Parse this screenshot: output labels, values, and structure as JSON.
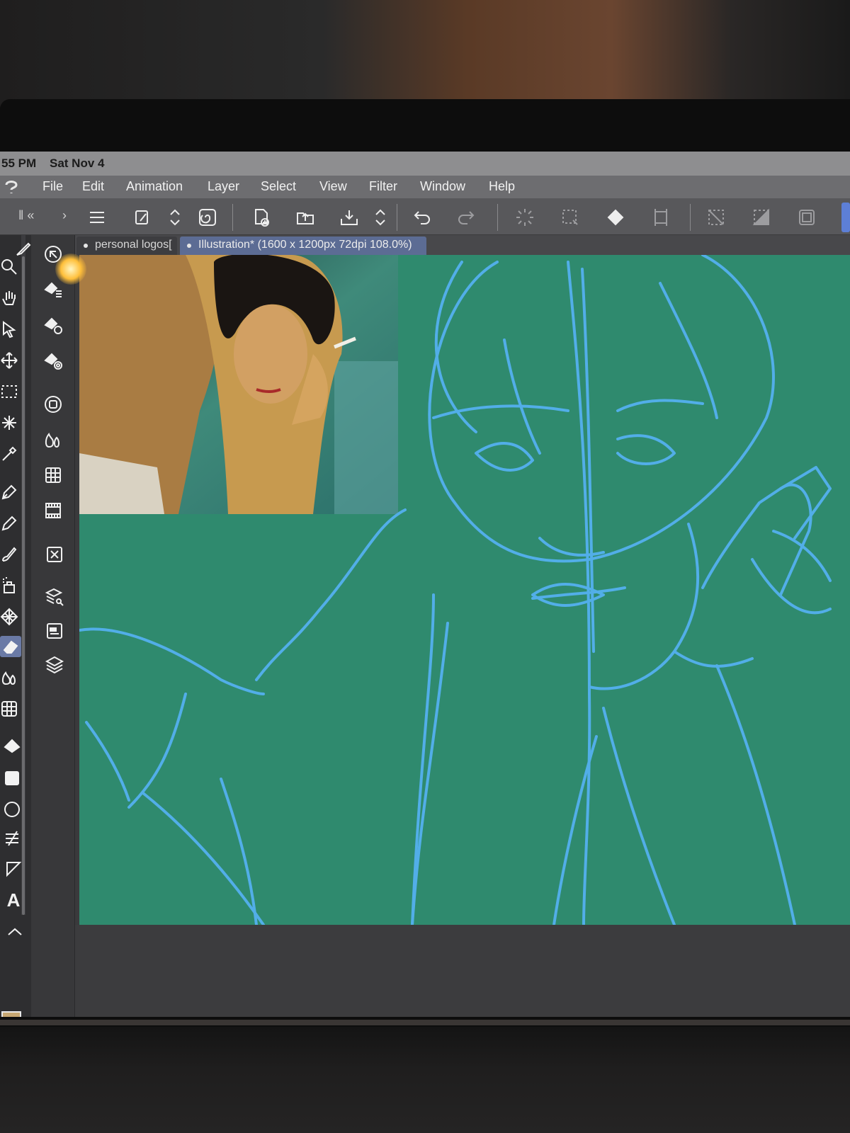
{
  "status_bar": {
    "time": "55 PM",
    "date": "Sat Nov 4"
  },
  "menu": {
    "items": [
      "File",
      "Edit",
      "Animation",
      "Layer",
      "Select",
      "View",
      "Filter",
      "Window",
      "Help"
    ]
  },
  "toolbar": {
    "icons": [
      "menu-icon",
      "new-file-icon",
      "chevron-updown-icon",
      "spiral-logo-icon",
      "new-canvas-icon",
      "open-folder-icon",
      "save-download-icon",
      "undo-icon",
      "redo-icon",
      "loading-spinner-icon",
      "marquee-select-icon",
      "fill-bucket-icon",
      "transform-icon",
      "deselect-icon",
      "invert-selection-icon",
      "crop-frame-icon"
    ]
  },
  "tabs": [
    {
      "label": "personal logos[",
      "active": false
    },
    {
      "label": "Illustration* (1600 x 1200px 72dpi 108.0%)",
      "active": true
    }
  ],
  "tools": {
    "main": [
      "pen-tool-icon",
      "magnifier-icon",
      "hand-icon",
      "select-arrow-icon",
      "move-icon",
      "rectangle-select-icon",
      "magic-wand-icon",
      "eyedropper-icon",
      "pen-nib-icon",
      "pencil-icon",
      "brush-icon",
      "airbrush-icon",
      "decoration-icon",
      "eraser-icon",
      "blend-icon",
      "figure-icon",
      "fill-icon",
      "gradient-icon",
      "ellipse-icon",
      "layer-cutter-icon",
      "ruler-icon",
      "text-icon",
      "balloon-icon"
    ],
    "text_tool_label": "A",
    "sub": [
      "navigator-icon",
      "tool-property-icon",
      "sub-tool-detail-icon",
      "brush-size-icon",
      "color-circle-icon",
      "color-set-icon",
      "intermediate-color-icon",
      "timeline-icon",
      "layer-property-icon",
      "layer-search-icon",
      "auto-action-icon",
      "layers-icon"
    ]
  },
  "colors": {
    "canvas": "#2f8a6e",
    "sketch_stroke": "#52aee8",
    "main_color": "#c7a772",
    "sub_color": "#69c4cc",
    "active_tab": "#5c6c94"
  }
}
